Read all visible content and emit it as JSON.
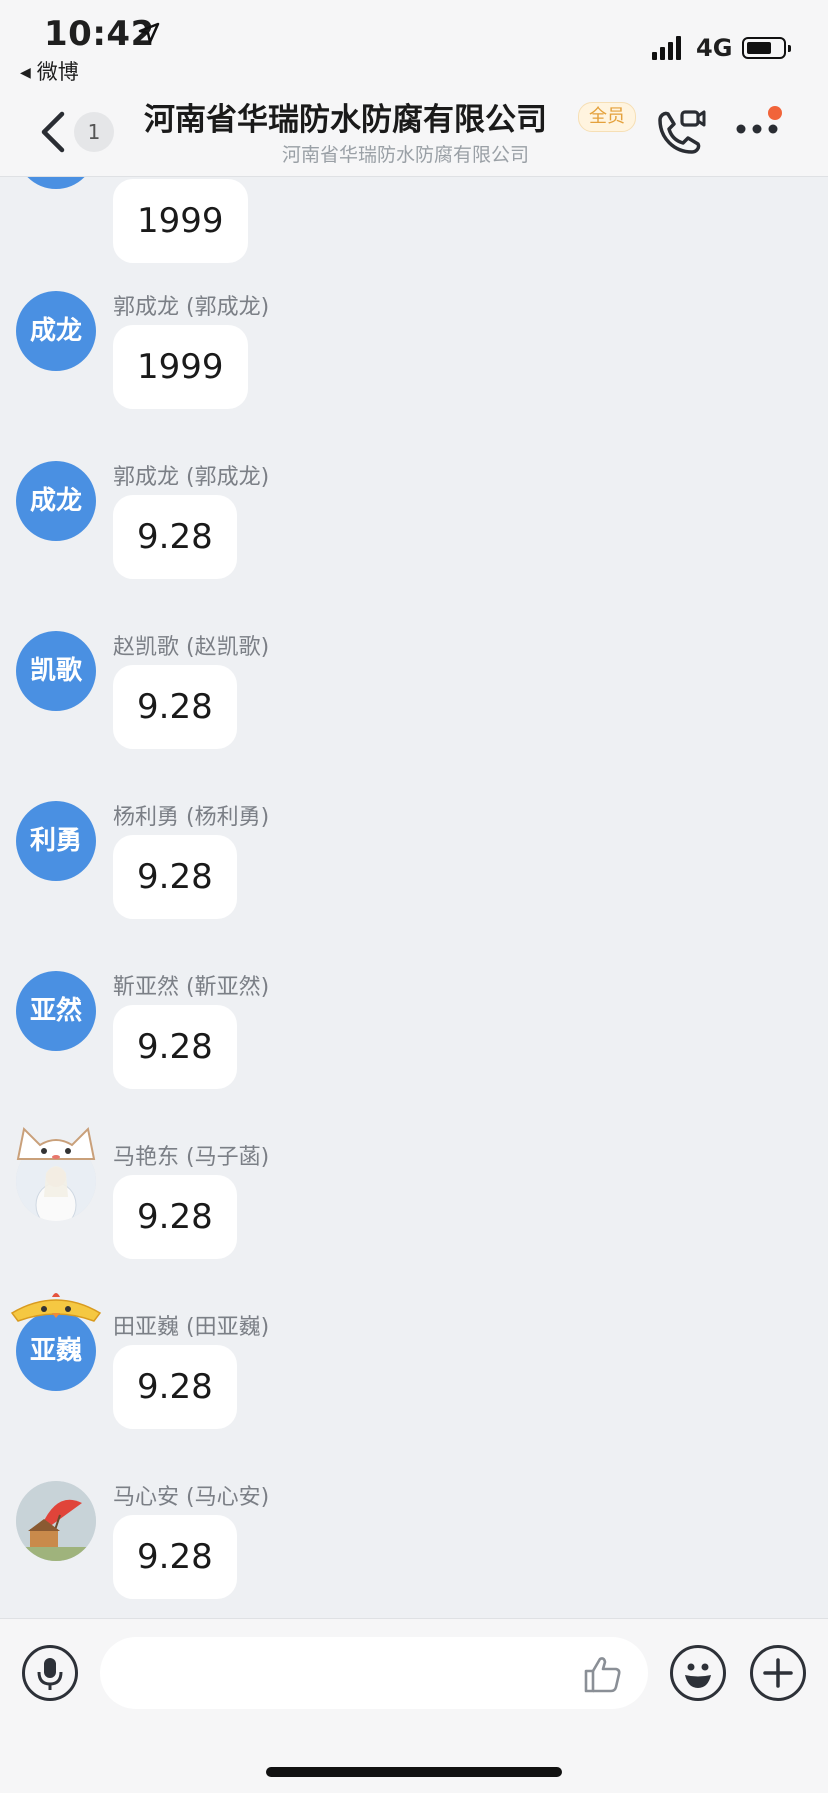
{
  "status_bar": {
    "time": "10:42",
    "back_app": "微博",
    "network": "4G"
  },
  "header": {
    "unread_count": "1",
    "title": "河南省华瑞防水防腐有限公司",
    "badge": "全员",
    "subtitle": "河南省华瑞防水防腐有限公司"
  },
  "messages": [
    {
      "avatar_text": "",
      "sender": "",
      "text": "1999"
    },
    {
      "avatar_text": "成龙",
      "sender": "郭成龙 (郭成龙)",
      "text": "1999"
    },
    {
      "avatar_text": "成龙",
      "sender": "郭成龙 (郭成龙)",
      "text": "9.28"
    },
    {
      "avatar_text": "凯歌",
      "sender": "赵凯歌 (赵凯歌)",
      "text": "9.28"
    },
    {
      "avatar_text": "利勇",
      "sender": "杨利勇 (杨利勇)",
      "text": "9.28"
    },
    {
      "avatar_text": "亚然",
      "sender": "靳亚然 (靳亚然)",
      "text": "9.28"
    },
    {
      "avatar_text": "",
      "sender": "马艳东 (马子菡)",
      "text": "9.28"
    },
    {
      "avatar_text": "亚巍",
      "sender": "田亚巍 (田亚巍)",
      "text": "9.28"
    },
    {
      "avatar_text": "",
      "sender": "马心安 (马心安)",
      "text": "9.28"
    }
  ],
  "input": {
    "placeholder": ""
  },
  "colors": {
    "accent_blue": "#4a90e2",
    "notify_dot": "#f1643a",
    "badge_text": "#e4a13c"
  }
}
